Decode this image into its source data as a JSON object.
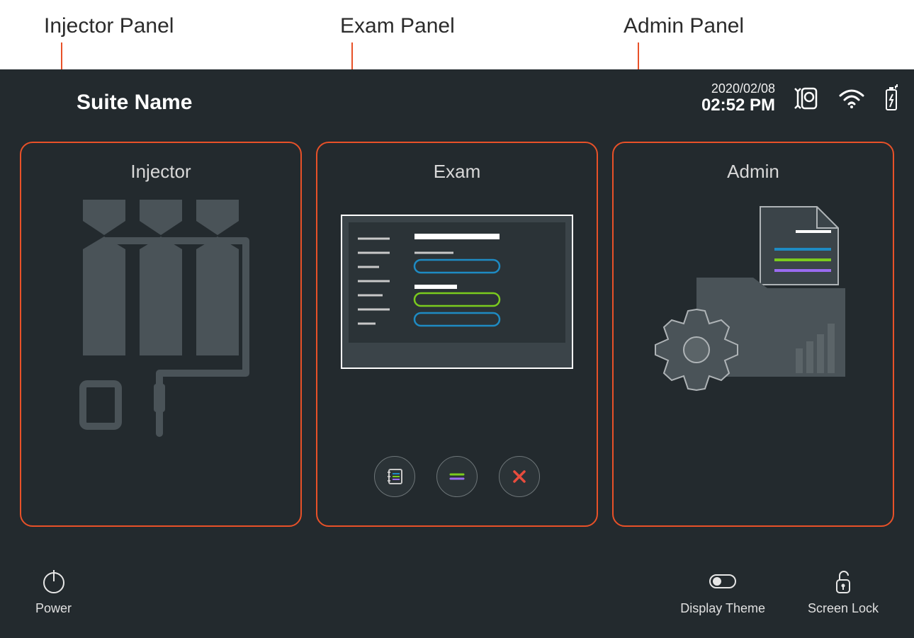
{
  "callouts": {
    "injector": "Injector Panel",
    "exam": "Exam Panel",
    "admin": "Admin Panel"
  },
  "suite_name": "Suite Name",
  "status": {
    "date": "2020/02/08",
    "time": "02:52 PM"
  },
  "panels": {
    "injector": {
      "title": "Injector"
    },
    "exam": {
      "title": "Exam"
    },
    "admin": {
      "title": "Admin"
    }
  },
  "bottom": {
    "power": "Power",
    "theme": "Display Theme",
    "lock": "Screen Lock"
  },
  "colors": {
    "accent": "#E85128",
    "blue": "#1E8BC3",
    "green": "#7BCB1E",
    "purple": "#9A6BF0",
    "red": "#E84C3D"
  }
}
